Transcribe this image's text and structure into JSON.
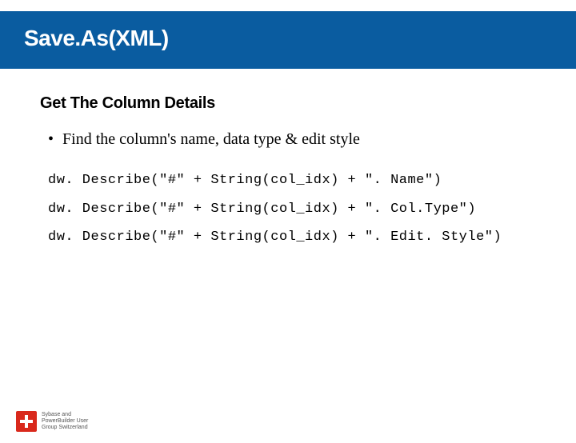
{
  "header": {
    "title": "Save.As(XML)"
  },
  "section": {
    "subheading": "Get The Column Details",
    "bullet": "Find the column's name, data type & edit style",
    "code_lines": [
      "dw. Describe(\"#\" + String(col_idx) + \". Name\")",
      "dw. Describe(\"#\" + String(col_idx) + \". Col.Type\")",
      "dw. Describe(\"#\" + String(col_idx) + \". Edit. Style\")"
    ]
  },
  "footer": {
    "logo_lines": [
      "Sybase and",
      "PowerBuilder User",
      "Group Switzerland"
    ]
  },
  "colors": {
    "accent": "#0a5ca0",
    "swiss_red": "#d9291c"
  }
}
